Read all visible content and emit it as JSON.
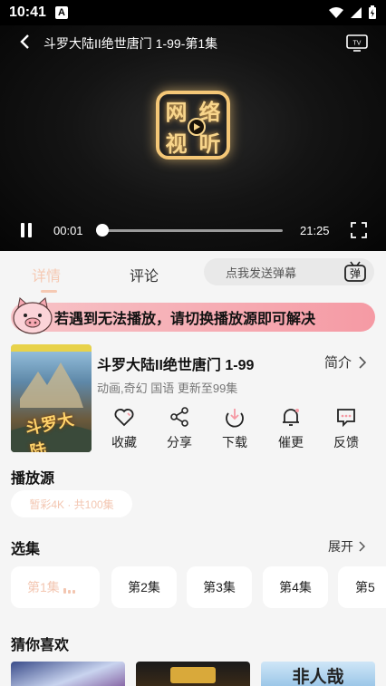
{
  "status_bar": {
    "time": "10:41"
  },
  "player": {
    "title": "斗罗大陆II绝世唐门 1-99-第1集",
    "logo_chars": [
      "网",
      "络",
      "视",
      "听"
    ],
    "current_time": "00:01",
    "duration": "21:25",
    "progress": 0.01
  },
  "tabs": {
    "detail": "详情",
    "comments": "评论",
    "danmu_placeholder": "点我发送弹幕",
    "danmu_button": "弹"
  },
  "notice": {
    "text": "若遇到无法播放，请切换播放源即可解决"
  },
  "info": {
    "title": "斗罗大陆II绝世唐门 1-99",
    "meta": "动画,奇幻 国语 更新至99集",
    "intro_label": "简介",
    "poster_text": "斗罗大陆",
    "actions": [
      {
        "label": "收藏",
        "icon": "heart-icon"
      },
      {
        "label": "分享",
        "icon": "share-icon"
      },
      {
        "label": "下载",
        "icon": "download-icon"
      },
      {
        "label": "催更",
        "icon": "bell-icon"
      },
      {
        "label": "反馈",
        "icon": "feedback-icon"
      }
    ]
  },
  "source": {
    "title": "播放源",
    "chip": "暂彩4K · 共100集"
  },
  "episodes": {
    "title": "选集",
    "expand_label": "展开",
    "items": [
      "第1集",
      "第2集",
      "第3集",
      "第4集",
      "第5"
    ]
  },
  "recommend": {
    "title": "猜你喜欢",
    "thumb3_text": "非人哉"
  },
  "colors": {
    "accent": "#f3c6b1",
    "notice_bg": "#f59aa4"
  }
}
